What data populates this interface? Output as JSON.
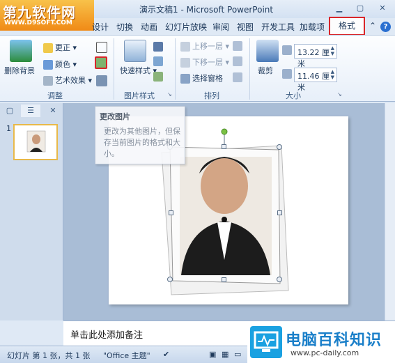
{
  "watermark": {
    "name": "第九软件网",
    "url": "WWW.D9SOFT.COM"
  },
  "window": {
    "title": "演示文稿1 - Microsoft PowerPoint"
  },
  "tabs": {
    "items": [
      "设计",
      "切换",
      "动画",
      "幻灯片放映",
      "审阅",
      "视图",
      "开发工具",
      "加载项"
    ],
    "active": "格式"
  },
  "ribbon": {
    "adjust": {
      "remove_bg": "删除背景",
      "correct": "更正",
      "color": "颜色",
      "artistic": "艺术效果",
      "label": "调整"
    },
    "picture_style": {
      "quick_style": "快速样式",
      "label": "图片样式"
    },
    "arrange": {
      "bring_forward": "上移一层",
      "send_backward": "下移一层",
      "selection_pane": "选择窗格",
      "label": "排列"
    },
    "size": {
      "crop": "裁剪",
      "height": "13.22 厘米",
      "width": "11.46 厘米",
      "label": "大小"
    }
  },
  "tooltip": {
    "title": "更改图片",
    "body": "更改为其他图片，但保存当前图片的格式和大小。"
  },
  "slides": {
    "thumb_number": "1"
  },
  "notes": {
    "placeholder": "单击此处添加备注"
  },
  "status": {
    "slide_info": "幻灯片 第 1 张，共 1 张",
    "theme": "\"Office 主题\""
  },
  "brand": {
    "name": "电脑百科知识",
    "url": "www.pc-daily.com"
  },
  "colors": {
    "accent": "#d9262a",
    "ribbon": "#e7eff9",
    "slide_bg": "#a9bdd6"
  }
}
